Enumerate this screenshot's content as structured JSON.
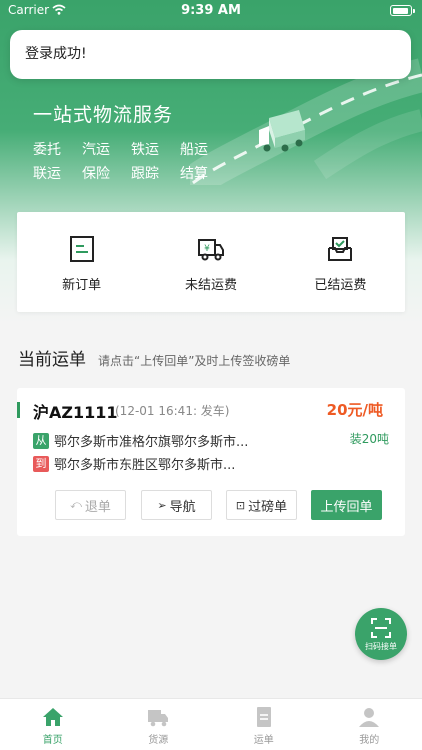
{
  "status_bar": {
    "carrier": "Carrier",
    "time": "9:39 AM"
  },
  "toast": {
    "message": "登录成功!"
  },
  "hero": {
    "title": "一站式物流服务",
    "services_row1": [
      "委托",
      "汽运",
      "铁运",
      "船运"
    ],
    "services_row2": [
      "联运",
      "保险",
      "跟踪",
      "结算"
    ]
  },
  "actions": [
    {
      "label": "新订单",
      "icon": "order-form-icon"
    },
    {
      "label": "未结运费",
      "icon": "truck-yen-icon"
    },
    {
      "label": "已结运费",
      "icon": "inbox-check-icon"
    }
  ],
  "current_orders": {
    "title": "当前运单",
    "hint": "请点击“上传回单”及时上传签收磅单"
  },
  "order": {
    "plate": "沪AZ1111",
    "depart": "(12-01 16:41: 发车)",
    "price": "20元/吨",
    "from_tag": "从",
    "from": "鄂尔多斯市准格尔旗鄂尔多斯市...",
    "to_tag": "到",
    "to": "鄂尔多斯市东胜区鄂尔多斯市...",
    "load": "装20吨",
    "buttons": {
      "cancel": "退单",
      "navigate": "导航",
      "weigh": "过磅单",
      "upload": "上传回单"
    }
  },
  "fab": {
    "label": "扫码接单"
  },
  "tabs": [
    {
      "label": "首页",
      "icon": "home-icon",
      "active": true
    },
    {
      "label": "货源",
      "icon": "truck-icon",
      "active": false
    },
    {
      "label": "运单",
      "icon": "document-icon",
      "active": false
    },
    {
      "label": "我的",
      "icon": "user-icon",
      "active": false
    }
  ],
  "colors": {
    "primary": "#3aa36a",
    "price": "#ee5a24",
    "from_tag": "#3aa36a",
    "to_tag": "#e85a5a"
  }
}
